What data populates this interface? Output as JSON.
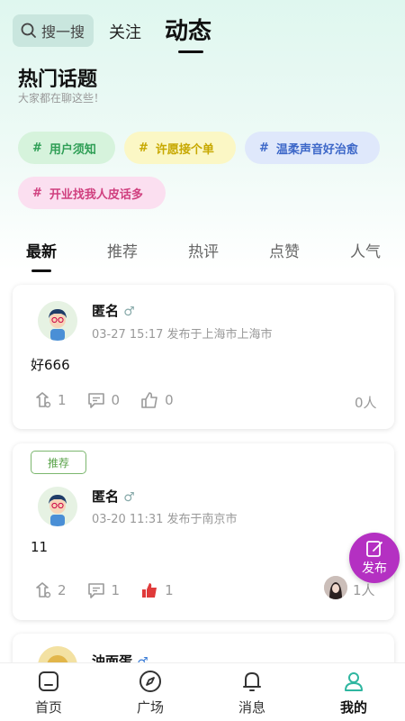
{
  "header": {
    "search_label": "搜一搜",
    "tab_follow": "关注",
    "tab_feed": "动态"
  },
  "hot": {
    "title": "热门话题",
    "subtitle": "大家都在聊这些！",
    "topics": [
      {
        "label": "用户须知",
        "color": "#2e9e55"
      },
      {
        "label": "许愿接个单",
        "color": "#c7a800"
      },
      {
        "label": "温柔声音好治愈",
        "color": "#3c67c8"
      },
      {
        "label": "开业找我人皮话多",
        "color": "#d0407f"
      }
    ],
    "hash": "#"
  },
  "tabs": [
    "最新",
    "推荐",
    "热评",
    "点赞",
    "人气"
  ],
  "posts": [
    {
      "name": "匿名",
      "gender": "♂",
      "meta": "03-27 15:17 发布于上海市上海市",
      "content": "好666",
      "gifts": "1",
      "comments": "0",
      "likes": "0",
      "people": "0人"
    },
    {
      "badge": "推荐",
      "name": "匿名",
      "gender": "♂",
      "meta": "03-20 11:31 发布于南京市",
      "content": "11",
      "gifts": "2",
      "comments": "1",
      "likes": "1",
      "people": "1人"
    },
    {
      "name": "油面蛋",
      "gender": "♂"
    }
  ],
  "fab_label": "发布",
  "bottom_nav": [
    "首页",
    "广场",
    "消息",
    "我的"
  ],
  "colors": {
    "accent": "#2fb6a0",
    "fab": "#b430c2",
    "like_active": "#e03a3a"
  }
}
